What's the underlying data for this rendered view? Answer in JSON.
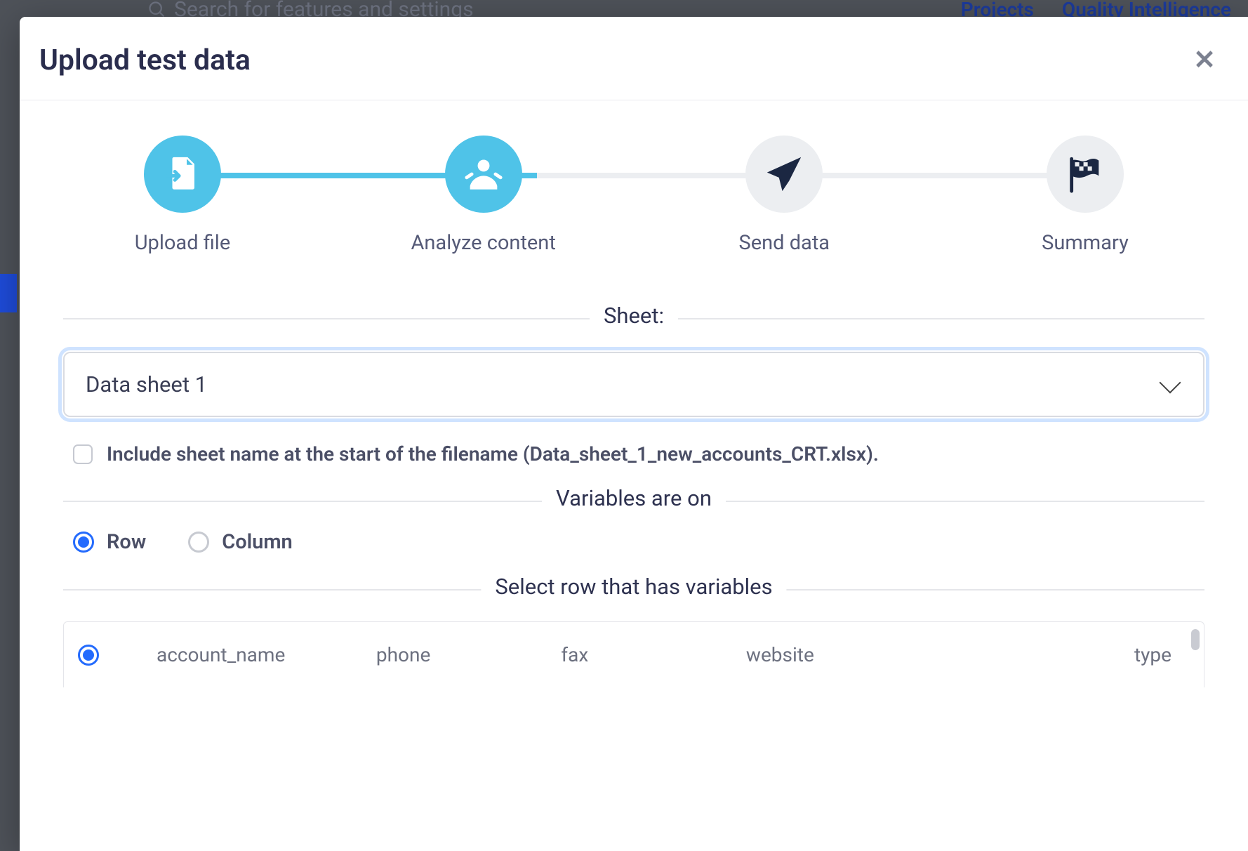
{
  "backdrop": {
    "search_placeholder": "Search for features and settings",
    "nav": {
      "projects": "Projects",
      "quality": "Quality Intelligence"
    }
  },
  "modal": {
    "title": "Upload test data"
  },
  "stepper": {
    "steps": [
      {
        "label": "Upload file",
        "state": "active"
      },
      {
        "label": "Analyze content",
        "state": "active"
      },
      {
        "label": "Send data",
        "state": "pending"
      },
      {
        "label": "Summary",
        "state": "pending"
      }
    ]
  },
  "sheet": {
    "legend": "Sheet:",
    "selected": "Data sheet 1",
    "include_label": "Include sheet name at the start of the filename (Data_sheet_1_new_accounts_CRT.xlsx)."
  },
  "variables": {
    "legend": "Variables are on",
    "options": {
      "row": "Row",
      "column": "Column"
    },
    "selected": "row"
  },
  "select_row": {
    "legend": "Select row that has variables",
    "columns": [
      "account_name",
      "phone",
      "fax",
      "website",
      "type"
    ]
  }
}
